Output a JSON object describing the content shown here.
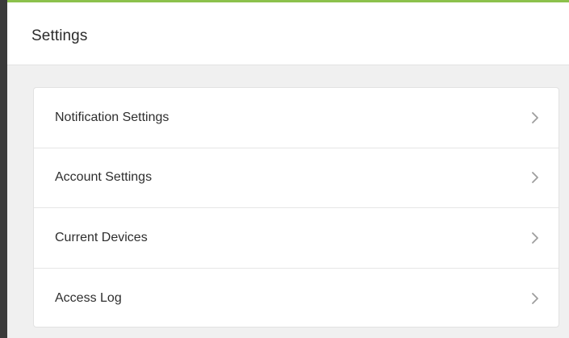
{
  "header": {
    "title": "Settings"
  },
  "settings_list": {
    "items": [
      {
        "label": "Notification Settings",
        "icon": "chevron-right-icon"
      },
      {
        "label": "Account Settings",
        "icon": "chevron-right-icon"
      },
      {
        "label": "Current Devices",
        "icon": "chevron-right-icon"
      },
      {
        "label": "Access Log",
        "icon": "chevron-right-icon"
      }
    ]
  },
  "colors": {
    "accent": "#8cc14c",
    "sidebar": "#3b3b3b",
    "background": "#f0f0f0",
    "chevron": "#9e9e9e"
  }
}
